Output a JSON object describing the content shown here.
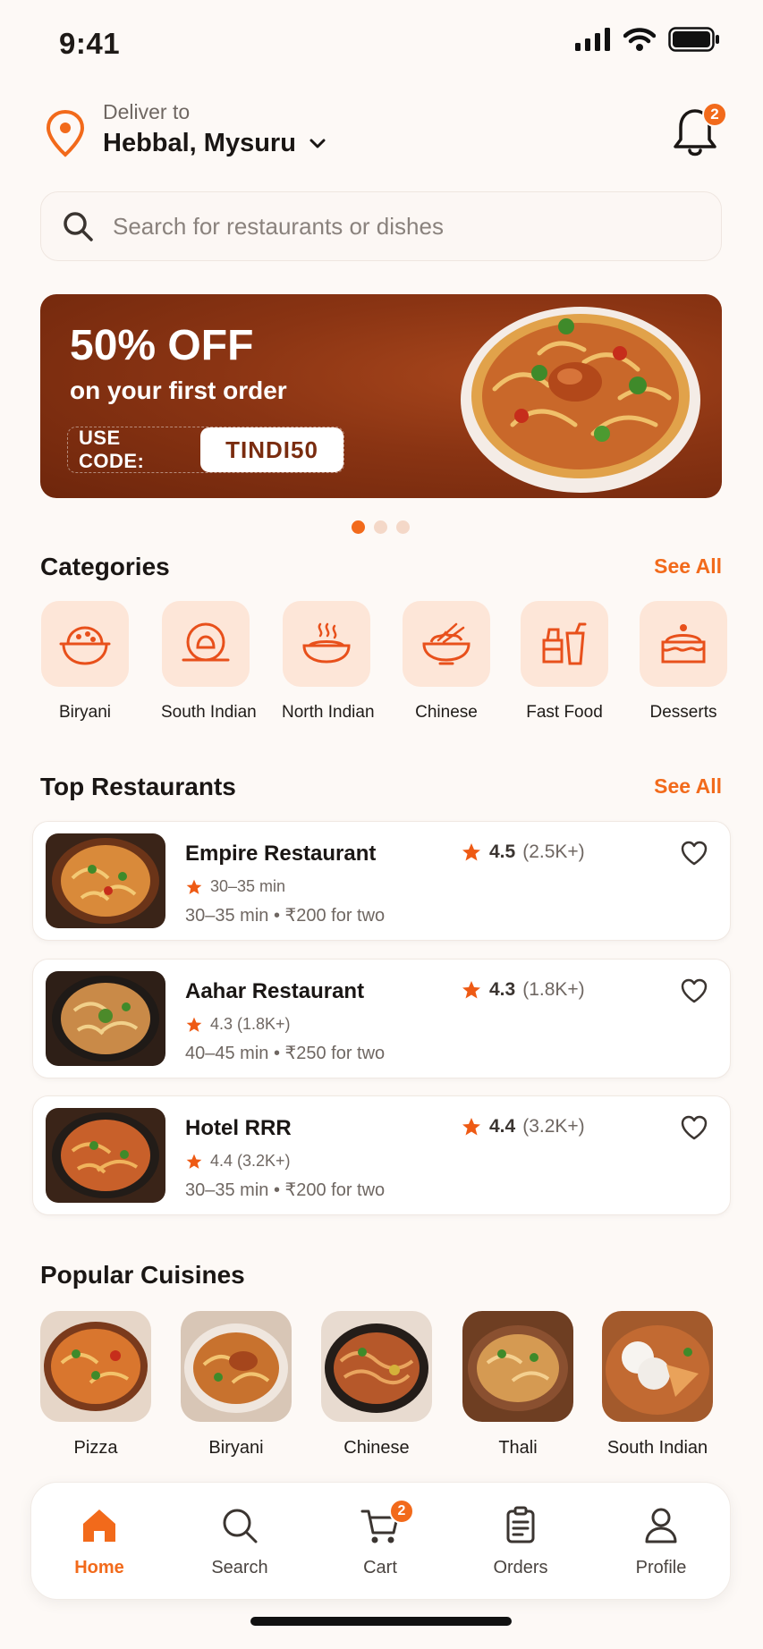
{
  "status_bar": {
    "time": "9:41"
  },
  "header": {
    "deliver_label": "Deliver to",
    "location": "Hebbal, Mysuru",
    "notification_count": "2"
  },
  "search": {
    "placeholder": "Search for restaurants or dishes"
  },
  "banner": {
    "title": "50% OFF",
    "subtitle": "on your first order",
    "code_label": "USE CODE:",
    "code_value": "TINDI50"
  },
  "carousel": {
    "total": 3,
    "active": 0
  },
  "categories": {
    "title": "Categories",
    "see_all": "See All",
    "items": [
      {
        "label": "Biryani",
        "icon": "biryani-icon"
      },
      {
        "label": "South Indian",
        "icon": "dosa-icon"
      },
      {
        "label": "North Indian",
        "icon": "curry-bowl-icon"
      },
      {
        "label": "Chinese",
        "icon": "noodles-icon"
      },
      {
        "label": "Fast Food",
        "icon": "fast-food-icon"
      },
      {
        "label": "Desserts",
        "icon": "cake-icon"
      }
    ]
  },
  "top_restaurants": {
    "title": "Top Restaurants",
    "see_all": "See All",
    "items": [
      {
        "name": "Empire Restaurant",
        "rating": "4.5",
        "rating_count": "(2.5K+)",
        "meta1": "30–35 min",
        "meta2": "30–35 min • ₹200 for two"
      },
      {
        "name": "Aahar Restaurant",
        "rating": "4.3",
        "rating_count": "(1.8K+)",
        "meta1": "4.3 (1.8K+)",
        "meta2": "40–45 min • ₹250 for two"
      },
      {
        "name": "Hotel RRR",
        "rating": "4.4",
        "rating_count": "(3.2K+)",
        "meta1": "4.4 (3.2K+)",
        "meta2": "30–35 min • ₹200 for two"
      }
    ]
  },
  "popular_cuisines": {
    "title": "Popular Cuisines",
    "items": [
      {
        "label": "Pizza"
      },
      {
        "label": "Biryani"
      },
      {
        "label": "Chinese"
      },
      {
        "label": "Thali"
      },
      {
        "label": "South Indian"
      }
    ]
  },
  "bottom_nav": {
    "items": [
      {
        "label": "Home",
        "icon": "home-icon",
        "active": true
      },
      {
        "label": "Search",
        "icon": "search-icon",
        "active": false
      },
      {
        "label": "Cart",
        "icon": "cart-icon",
        "active": false,
        "badge": "2"
      },
      {
        "label": "Orders",
        "icon": "orders-icon",
        "active": false
      },
      {
        "label": "Profile",
        "icon": "profile-icon",
        "active": false
      }
    ]
  },
  "colors": {
    "accent": "#f26a1b",
    "background": "#fdf9f6",
    "banner": "#8a3413",
    "category_tile": "#fde6d8"
  }
}
